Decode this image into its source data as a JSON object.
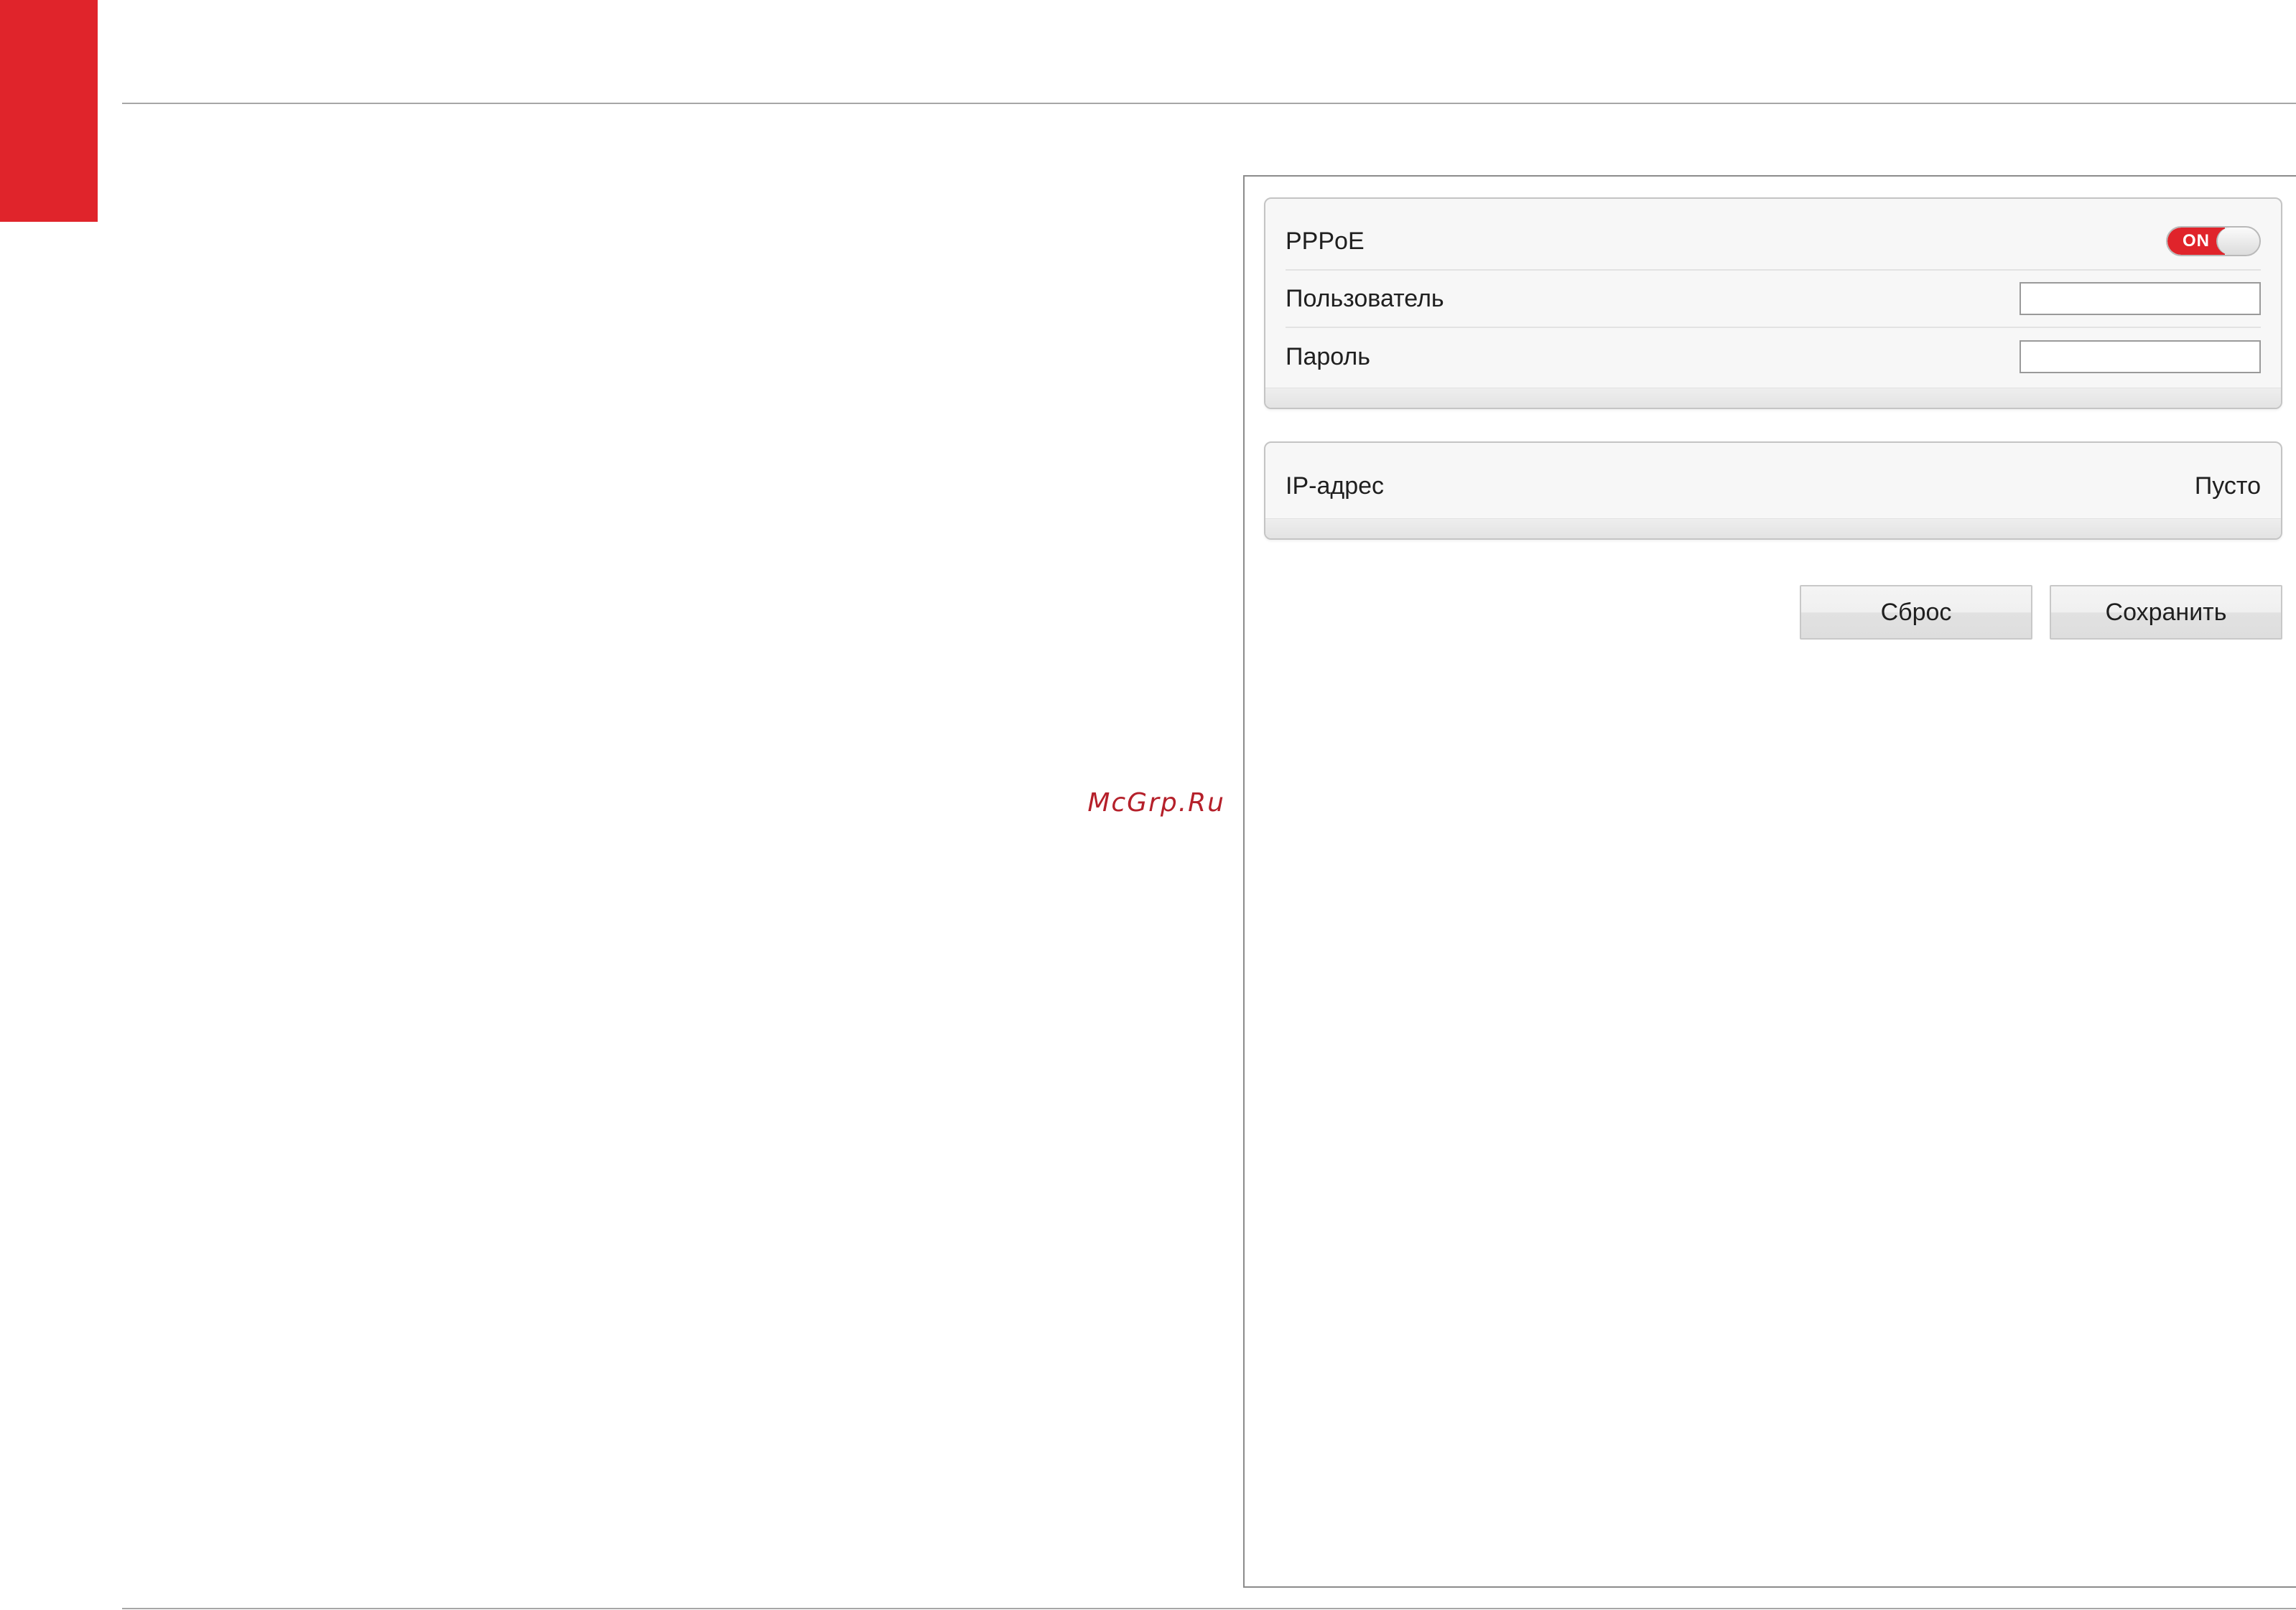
{
  "pppoe_panel": {
    "pppoe_label": "PPPoE",
    "toggle_state": "ON",
    "user_label": "Пользователь",
    "user_value": "",
    "password_label": "Пароль",
    "password_value": ""
  },
  "ip_panel": {
    "ip_label": "IP-адрес",
    "ip_value": "Пусто"
  },
  "buttons": {
    "reset_label": "Сброс",
    "save_label": "Сохранить"
  },
  "watermark": {
    "text": "McGrp.Ru"
  },
  "colors": {
    "accent": "#e0242b",
    "watermark": "#b5202a"
  }
}
